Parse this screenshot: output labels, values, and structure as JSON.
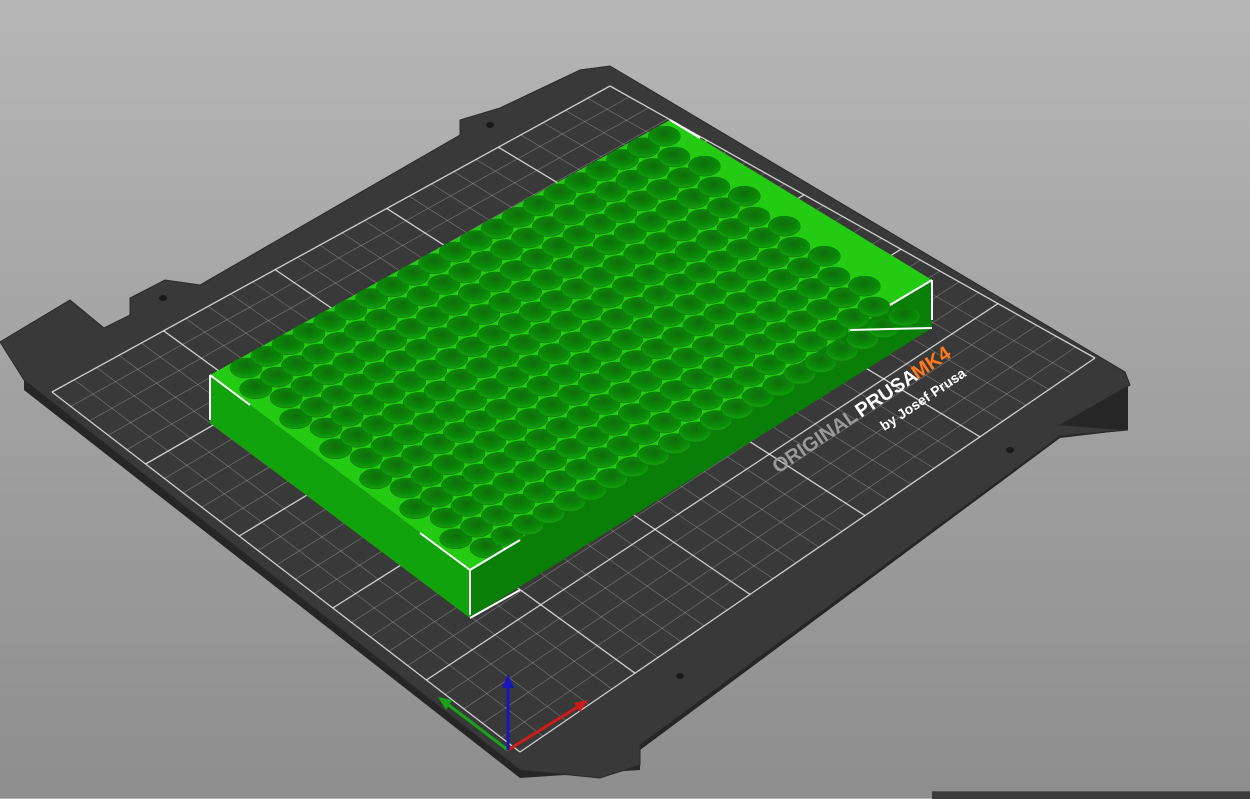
{
  "bed": {
    "logo_original": "ORIGINAL",
    "logo_prusa": "PRUSA",
    "logo_model": "MK4",
    "logo_byline": "by Josef Prusa"
  },
  "colors": {
    "background": "#a6a6a6",
    "bed_plate": "#3a3a3a",
    "bed_grid": "#ffffff",
    "model_green": "#22cc11",
    "brand_orange": "#ff7a1a",
    "axis_x": "#d11b1b",
    "axis_y": "#19a319",
    "axis_z": "#1818b8"
  },
  "model": {
    "name": "tray-with-holes",
    "hole_columns": 22,
    "hole_rows": 13
  }
}
